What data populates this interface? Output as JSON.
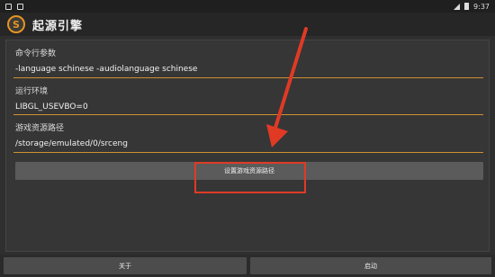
{
  "status_bar": {
    "time": "9:37"
  },
  "app": {
    "title": "起源引擎",
    "logo_letter": "S"
  },
  "form": {
    "args_label": "命令行参数",
    "args_value": "-language schinese -audiolanguage schinese",
    "env_label": "运行环境",
    "env_value": "LIBGL_USEVBO=0",
    "path_label": "游戏资源路径",
    "path_value": "/storage/emulated/0/srceng"
  },
  "set_path_button": "设置游戏资源路径",
  "bottom": {
    "about_label": "关于",
    "start_label": "启动"
  },
  "colors": {
    "accent": "#d0902e",
    "annotation": "#e03a25"
  }
}
